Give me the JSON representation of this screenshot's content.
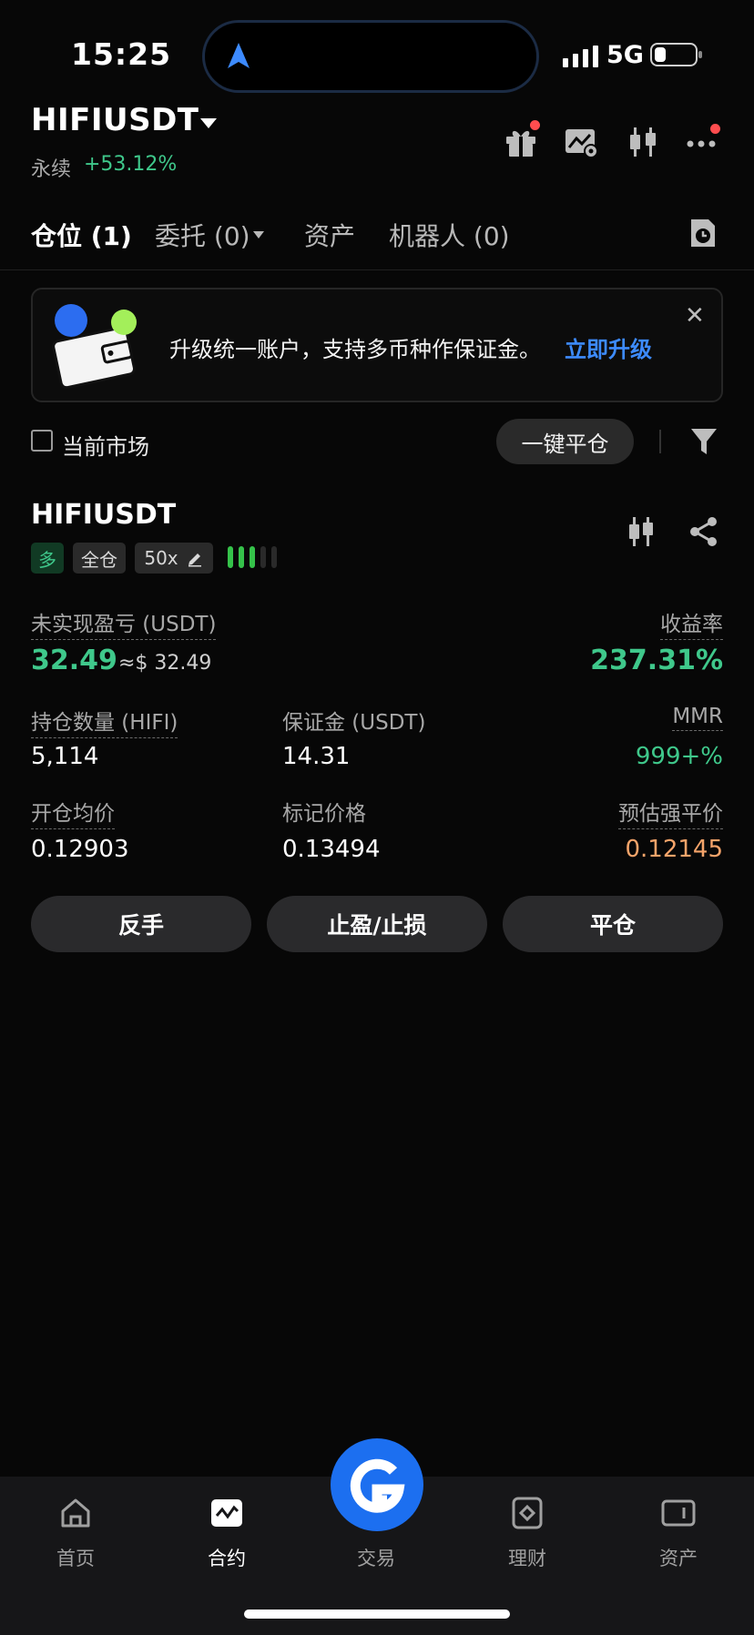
{
  "status_bar": {
    "time": "15:25",
    "network": "5G"
  },
  "header": {
    "pair": "HIFIUSDT",
    "contract_type": "永续",
    "change": "+53.12%"
  },
  "tabs": [
    {
      "label": "仓位 (1)"
    },
    {
      "label": "委托 (0)"
    },
    {
      "label": "资产"
    },
    {
      "label": "机器人 (0)"
    }
  ],
  "banner": {
    "text": "升级统一账户，支持多币种作保证金。",
    "link": "立即升级",
    "close": "✕"
  },
  "filter": {
    "checkbox_label": "当前市场",
    "close_all": "一键平仓"
  },
  "position": {
    "symbol": "HIFIUSDT",
    "side": "多",
    "margin_mode": "全仓",
    "leverage": "50x",
    "unrealized_pnl_label": "未实现盈亏 (USDT)",
    "unrealized_pnl": "32.49",
    "unrealized_pnl_approx": "≈$ 32.49",
    "roe_label": "收益率",
    "roe": "237.31%",
    "size_label": "持仓数量 (HIFI)",
    "size": "5,114",
    "margin_label": "保证金 (USDT)",
    "margin": "14.31",
    "mmr_label": "MMR",
    "mmr": "999+%",
    "entry_label": "开仓均价",
    "entry": "0.12903",
    "mark_label": "标记价格",
    "mark": "0.13494",
    "liq_label": "预估强平价",
    "liq": "0.12145"
  },
  "actions": {
    "reverse": "反手",
    "tpsl": "止盈/止损",
    "close": "平仓"
  },
  "bottom_nav": [
    {
      "label": "首页"
    },
    {
      "label": "合约"
    },
    {
      "label": "交易"
    },
    {
      "label": "理财"
    },
    {
      "label": "资产"
    }
  ],
  "colors": {
    "green": "#3fc88b",
    "orange": "#f6a46a",
    "blue": "#3d8bff",
    "fab": "#1c6ff0"
  }
}
